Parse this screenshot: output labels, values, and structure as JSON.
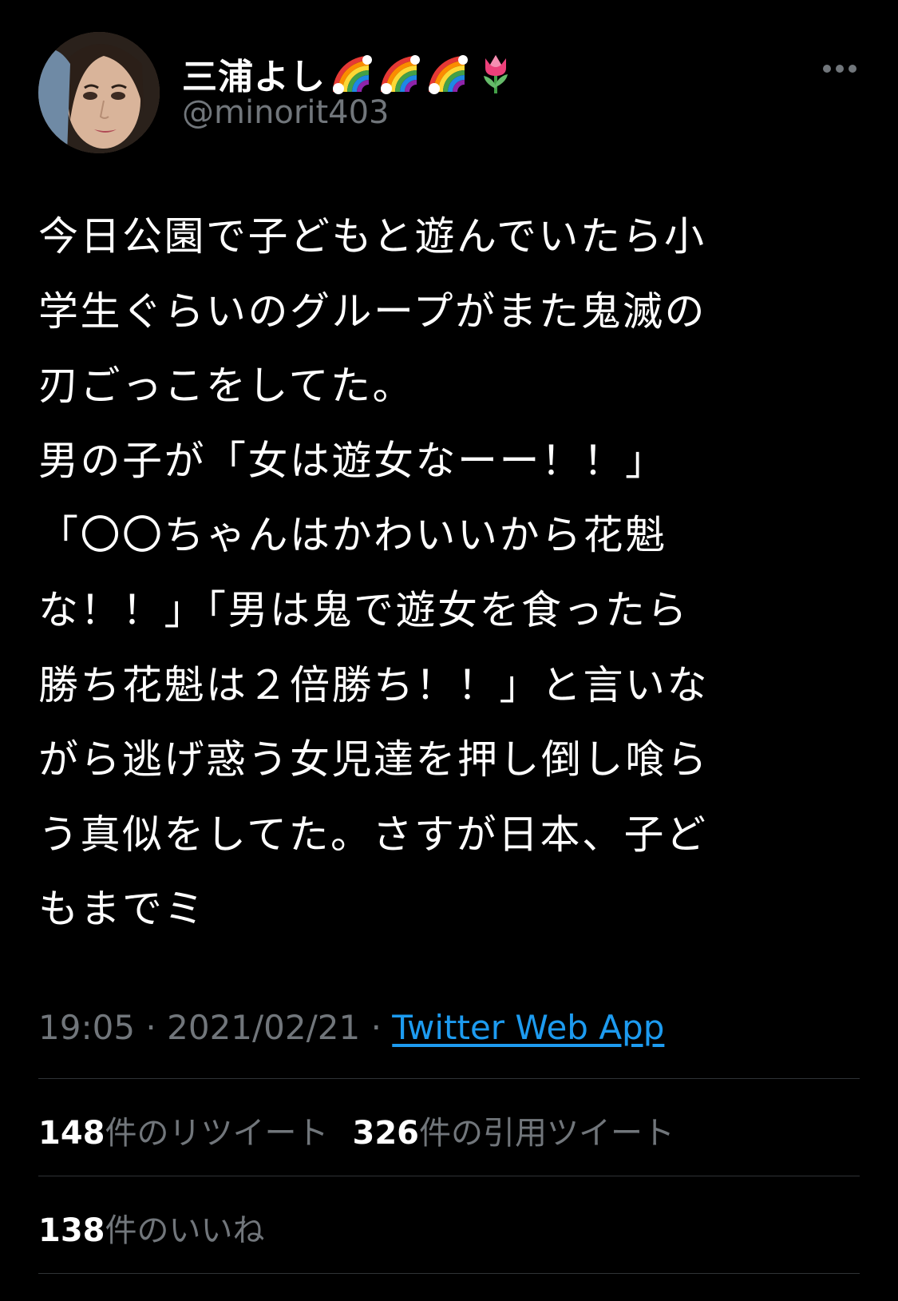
{
  "author": {
    "display_name": "三浦よし",
    "handle": "@minorit403",
    "name_emojis": [
      "rainbow-emoji",
      "rainbow-emoji",
      "rainbow-emoji",
      "tulip-emoji"
    ]
  },
  "tweet": {
    "lines": [
      "今日公園で子どもと遊んでいたら小",
      "学生ぐらいのグループがまた鬼滅の",
      "刃ごっこをしてた。",
      "男の子が「女は遊女なーー！！」",
      "「〇〇ちゃんはかわいいから花魁",
      "な！！」「男は鬼で遊女を食ったら",
      "勝ち花魁は２倍勝ち！！」と言いな",
      "がら逃げ惑う女児達を押し倒し喰ら",
      "う真似をしてた。さすが日本、子ど",
      "もまでミ"
    ],
    "time": "19:05",
    "date": "2021/02/21",
    "separator": "·",
    "source": "Twitter Web App"
  },
  "stats": {
    "retweets_count": "148",
    "retweets_label": "件のリツイート",
    "quotes_count": "326",
    "quotes_label": "件の引用ツイート",
    "likes_count": "138",
    "likes_label": "件のいいね"
  },
  "colors": {
    "background": "#000000",
    "text_primary": "#ffffff",
    "text_secondary": "#71767b",
    "link": "#1d9bf0",
    "divider": "#2f3336"
  }
}
